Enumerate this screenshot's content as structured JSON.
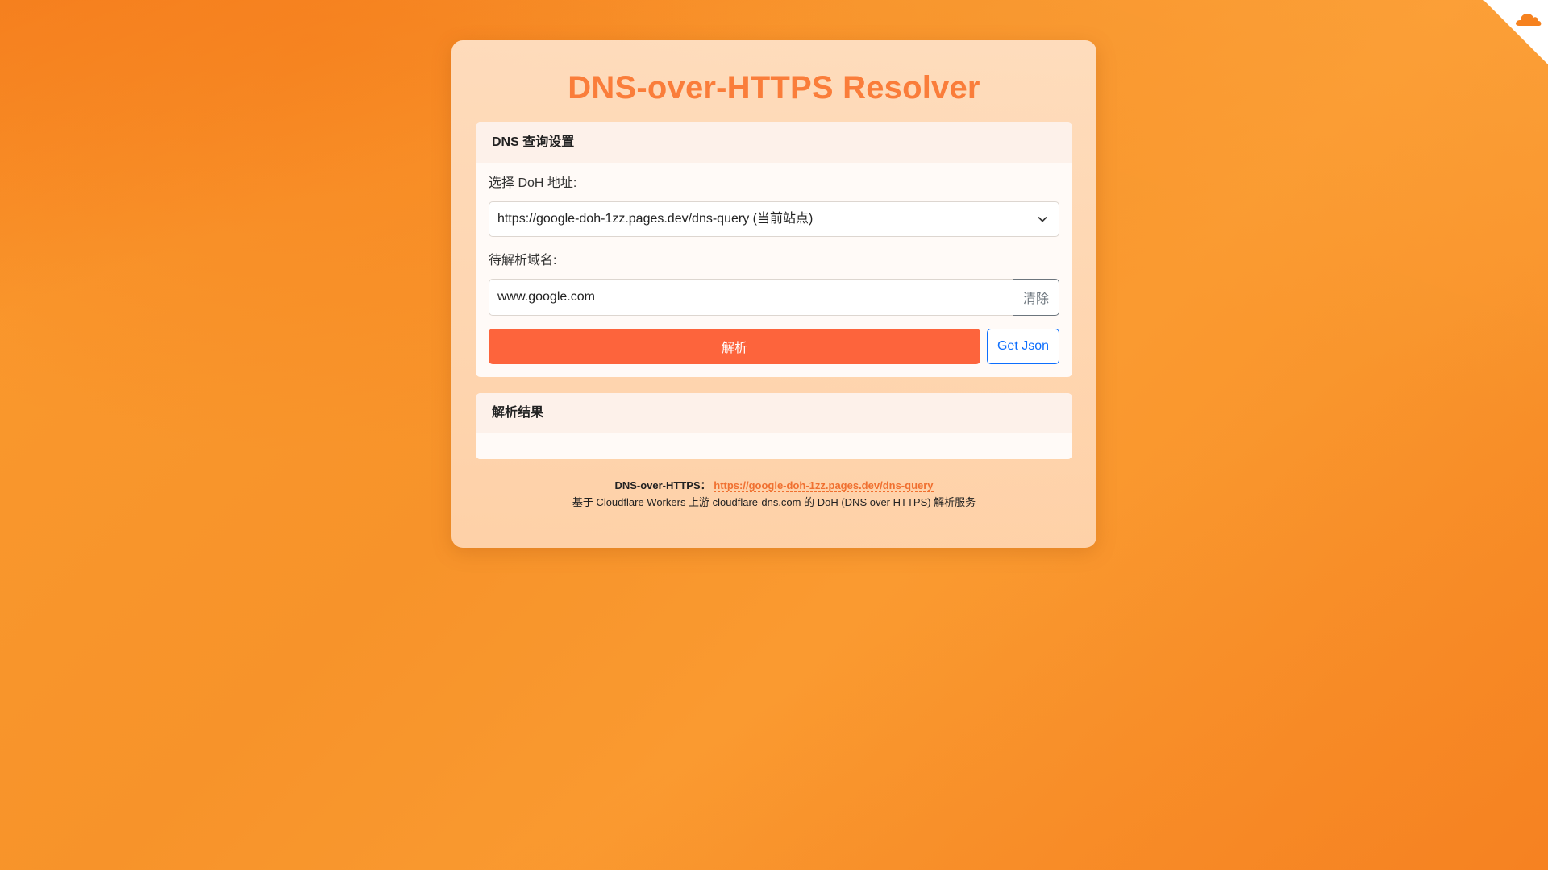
{
  "title": "DNS-over-HTTPS Resolver",
  "settings": {
    "header": "DNS 查询设置",
    "doh_label": "选择 DoH 地址:",
    "doh_selected": "https://google-doh-1zz.pages.dev/dns-query (当前站点)",
    "domain_label": "待解析域名:",
    "domain_value": "www.google.com",
    "clear_label": "清除",
    "resolve_label": "解析",
    "json_label": "Get Json"
  },
  "results": {
    "header": "解析结果"
  },
  "footer": {
    "label": "DNS-over-HTTPS：",
    "link": "https://google-doh-1zz.pages.dev/dns-query",
    "description": "基于 Cloudflare Workers 上游 cloudflare-dns.com 的 DoH (DNS over HTTPS) 解析服务"
  },
  "icons": {
    "corner": "cloudflare-icon",
    "select": "chevron-down-icon"
  },
  "colors": {
    "accent": "#fa7d3a",
    "primary_button": "#fd643c",
    "secondary_button": "#0d6efd",
    "background": "#f7932a"
  }
}
